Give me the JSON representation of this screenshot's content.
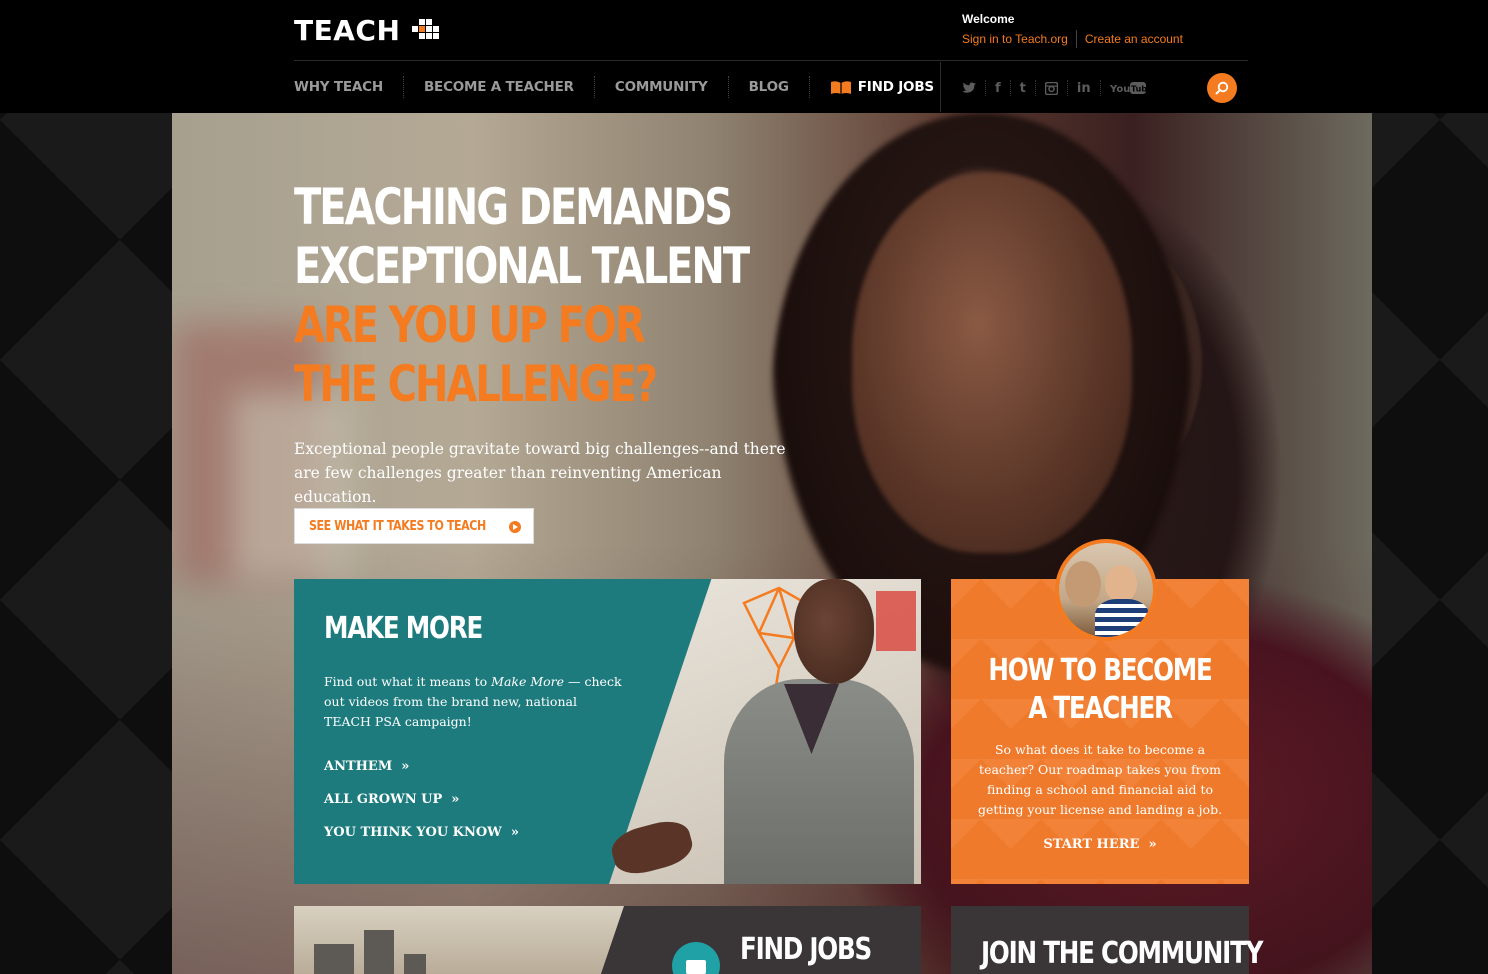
{
  "brand": {
    "logo_text": "TEACH"
  },
  "account": {
    "welcome": "Welcome",
    "sign_in": "Sign in to Teach.org",
    "create": "Create an account"
  },
  "nav": {
    "items": [
      "WHY TEACH",
      "BECOME A TEACHER",
      "COMMUNITY",
      "BLOG"
    ],
    "find_jobs": "FIND JOBS"
  },
  "social": {
    "twitter": "t-bird",
    "facebook": "f",
    "tumblr": "t",
    "instagram": "instagram",
    "linkedin": "in",
    "youtube": "YouTube"
  },
  "hero": {
    "headline_1": "TEACHING DEMANDS",
    "headline_2": "EXCEPTIONAL TALENT",
    "headline_3": "ARE YOU UP FOR",
    "headline_4": "THE CHALLENGE?",
    "body": "Exceptional people gravitate toward big challenges--and there are few challenges greater than reinventing American education.",
    "cta": "SEE WHAT IT TAKES TO TEACH"
  },
  "make_more": {
    "title": "MAKE MORE",
    "body_pre": "Find out what it means to ",
    "body_em": "Make More",
    "body_post": " — check out videos from the brand new, national TEACH PSA campaign!",
    "links": [
      "ANTHEM",
      "ALL GROWN UP",
      "YOU THINK YOU KNOW"
    ]
  },
  "become": {
    "title_1": "HOW TO BECOME",
    "title_2": "A TEACHER",
    "body": "So what does it take to become a teacher? Our roadmap takes you from finding a school and financial aid to getting your license and landing a job.",
    "link": "START HERE"
  },
  "jobs_card": {
    "title": "FIND JOBS"
  },
  "community_card": {
    "title": "JOIN THE COMMUNITY"
  },
  "colors": {
    "accent": "#f47b20",
    "teal": "#1d7b7e",
    "orange_card": "#f07a2b",
    "dark": "#000000"
  },
  "icons": [
    "book-icon",
    "twitter-icon",
    "facebook-icon",
    "tumblr-icon",
    "instagram-icon",
    "linkedin-icon",
    "youtube-icon",
    "search-icon",
    "play-icon",
    "chevron-right-icon",
    "briefcase-icon"
  ]
}
